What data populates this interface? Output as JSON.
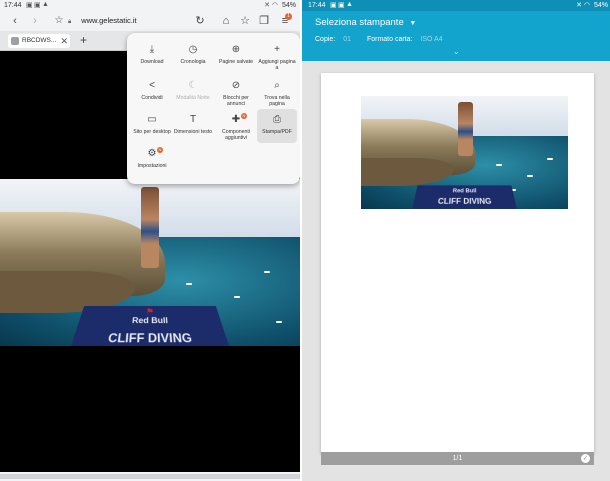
{
  "left_status": {
    "time": "17:44",
    "battery": "54%"
  },
  "browser": {
    "url": "www.gelestatic.it",
    "lock_icon": "lock-icon",
    "menu_badge": "1",
    "tab_label": "RBCDWS...",
    "menu_items": [
      {
        "label": "Download",
        "icon": "⤓",
        "disabled": false,
        "selected": false
      },
      {
        "label": "Cronologia",
        "icon": "◷",
        "disabled": false,
        "selected": false
      },
      {
        "label": "Pagine salvate",
        "icon": "⊕",
        "disabled": false,
        "selected": false
      },
      {
        "label": "Aggiungi pagina a",
        "icon": "+",
        "disabled": false,
        "selected": false
      },
      {
        "label": "Condividi",
        "icon": "<",
        "disabled": false,
        "selected": false
      },
      {
        "label": "Modalità Notte",
        "icon": "☾",
        "disabled": true,
        "selected": false
      },
      {
        "label": "Blocchi per annunci",
        "icon": "⊘",
        "disabled": false,
        "selected": false
      },
      {
        "label": "Trova nella pagina",
        "icon": "⌕",
        "disabled": false,
        "selected": false
      },
      {
        "label": "Sito per desktop",
        "icon": "▭",
        "disabled": false,
        "selected": false
      },
      {
        "label": "Dimensioni testo",
        "icon": "T",
        "disabled": false,
        "selected": false
      },
      {
        "label": "Componenti aggiuntivi",
        "icon": "✚",
        "disabled": false,
        "selected": false,
        "badge": "N"
      },
      {
        "label": "Stampa/PDF",
        "icon": "⎙",
        "disabled": false,
        "selected": true
      },
      {
        "label": "Impostazioni",
        "icon": "⚙",
        "disabled": false,
        "selected": false,
        "badge": "N"
      }
    ]
  },
  "photo": {
    "banner_text": "CLIFF DIVING",
    "brand_text": "Red Bull"
  },
  "right_status": {
    "time": "17:44",
    "battery": "54%"
  },
  "print": {
    "title": "Seleziona stampante",
    "copies_label": "Copie:",
    "copies_value": "01",
    "paper_label": "Formato carta:",
    "paper_value": "ISO A4",
    "page_indicator": "1/1"
  },
  "colors": {
    "header": "#13a4cd",
    "accent": "#e8632b"
  }
}
